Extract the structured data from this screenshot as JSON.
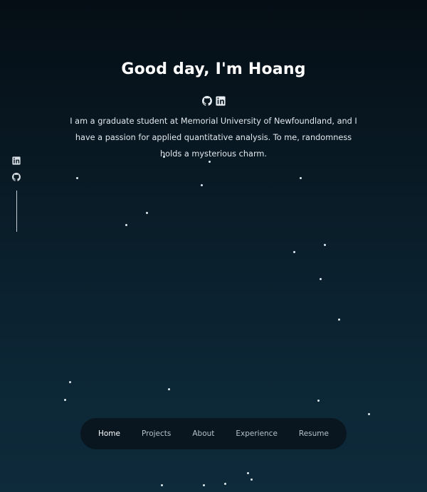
{
  "hero": {
    "title": "Good day, I'm Hoang",
    "icons": [
      "github-icon",
      "linkedin-icon"
    ],
    "bio": "I am a graduate student at Memorial University of Newfoundland, and I have a passion for applied quantitative analysis. To me, randomness holds a mysterious charm."
  },
  "side_social": {
    "icons": [
      "linkedin-icon",
      "github-icon"
    ]
  },
  "nav": {
    "items": [
      {
        "label": "Home",
        "active": true
      },
      {
        "label": "Projects",
        "active": false
      },
      {
        "label": "About",
        "active": false
      },
      {
        "label": "Experience",
        "active": false
      },
      {
        "label": "Resume",
        "active": false
      }
    ]
  },
  "colors": {
    "background_top": "#050e15",
    "background_bottom": "#0e2b3b",
    "nav_background": "#09161f",
    "text": "#e6edf2",
    "star": "#dfe9ef"
  }
}
